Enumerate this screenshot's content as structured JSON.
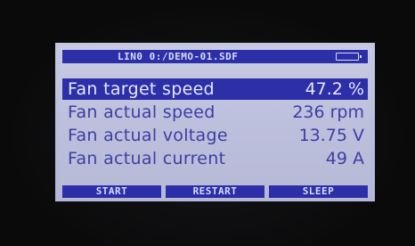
{
  "screen": {
    "title": "LIN0 0:/DEMO-01.SDF",
    "battery_icon": "battery-icon"
  },
  "rows": [
    {
      "label": "Fan target speed",
      "value": "47.2 %",
      "selected": true
    },
    {
      "label": "Fan actual speed",
      "value": "236 rpm",
      "selected": false
    },
    {
      "label": "Fan actual voltage",
      "value": "13.75 V",
      "selected": false
    },
    {
      "label": "Fan actual current",
      "value": "49 A",
      "selected": false
    }
  ],
  "softkeys": [
    "START",
    "RESTART",
    "SLEEP"
  ],
  "colors": {
    "lcd_background": "#c2c5e0",
    "highlight": "#2c2fa8",
    "text": "#3b3fa6",
    "inverse_text": "#e6e8fb"
  }
}
